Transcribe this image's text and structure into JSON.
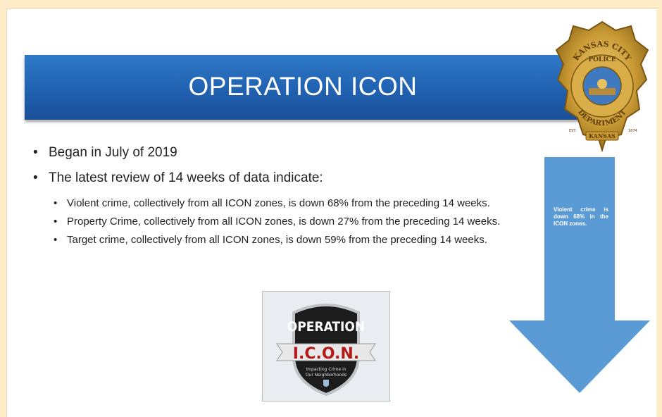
{
  "slide": {
    "title": "OPERATION ICON",
    "bullets": [
      "Began in July of 2019",
      "The latest review of 14 weeks of data indicate:"
    ],
    "sub_bullets": [
      "Violent crime, collectively from all ICON zones, is down 68% from the preceding 14 weeks.",
      "Property Crime, collectively from all ICON zones, is down 27% from the preceding 14 weeks.",
      "Target crime, collectively from all ICON zones, is down 59% from the preceding 14 weeks."
    ],
    "arrow_text": "Violent crime is down 68% in the ICON zones."
  },
  "badge": {
    "top_text": "KANSAS CITY",
    "line2": "POLICE",
    "bottom_text": "DEPARTMENT",
    "ribbon": "KANSAS",
    "est_left": "EST.",
    "est_right": "1874"
  },
  "logo": {
    "line1": "OPERATION",
    "line2": "I.C.O.N.",
    "tagline1": "Impacting Crime in",
    "tagline2": "Our Neighborhoods"
  },
  "colors": {
    "title_bar": "#1f5fae",
    "arrow": "#5b9bd5",
    "page_bg": "#fdecc7",
    "logo_red": "#b31b1b"
  }
}
